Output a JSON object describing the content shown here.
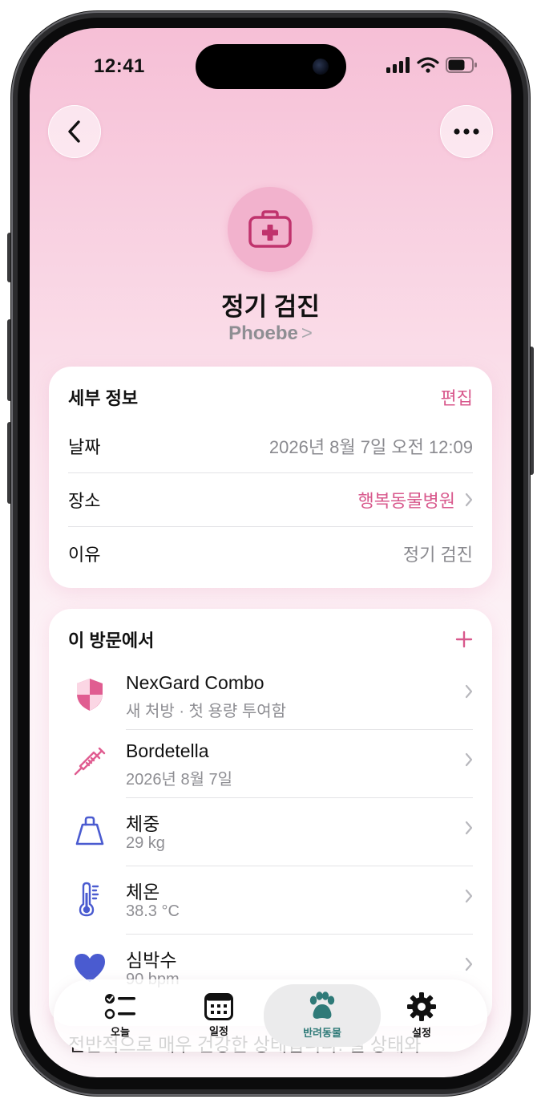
{
  "status_bar": {
    "time": "12:41"
  },
  "header": {
    "back_icon": "chevron-left-icon",
    "more_icon": "ellipsis-icon"
  },
  "hero": {
    "icon": "medical-kit-icon",
    "title": "정기 검진",
    "pet_name": "Phoebe",
    "pet_chevron": ">"
  },
  "details": {
    "title": "세부 정보",
    "edit_label": "편집",
    "rows": [
      {
        "label": "날짜",
        "value": "2026년 8월 7일 오전 12:09"
      },
      {
        "label": "장소",
        "value": "행복동물병원"
      },
      {
        "label": "이유",
        "value": "정기 검진"
      }
    ]
  },
  "visit": {
    "title": "이 방문에서",
    "add_icon": "plus-icon",
    "items": [
      {
        "icon": "shield-icon",
        "title": "NexGard Combo",
        "subtitle": "새 처방 · 첫 용량 투여함"
      },
      {
        "icon": "syringe-icon",
        "title": "Bordetella",
        "subtitle": "2026년 8월 7일"
      },
      {
        "icon": "weight-icon",
        "title": "체중",
        "subtitle": "29 kg"
      },
      {
        "icon": "thermometer-icon",
        "title": "체온",
        "subtitle": "38.3 °C"
      },
      {
        "icon": "heart-icon",
        "title": "심박수",
        "subtitle": "90 bpm"
      }
    ]
  },
  "notes_text": "전반적으로 매우 건강한 상태입니다. 털 상태와",
  "tabbar": {
    "tabs": [
      {
        "label": "오늘",
        "icon": "checklist-icon"
      },
      {
        "label": "일정",
        "icon": "calendar-icon"
      },
      {
        "label": "반려동물",
        "icon": "paw-icon",
        "active": true
      },
      {
        "label": "설정",
        "icon": "gear-icon"
      }
    ]
  },
  "colors": {
    "accent": "#d8588c",
    "tab_active": "#2f7a78",
    "icon_blue": "#4a5bd0"
  }
}
